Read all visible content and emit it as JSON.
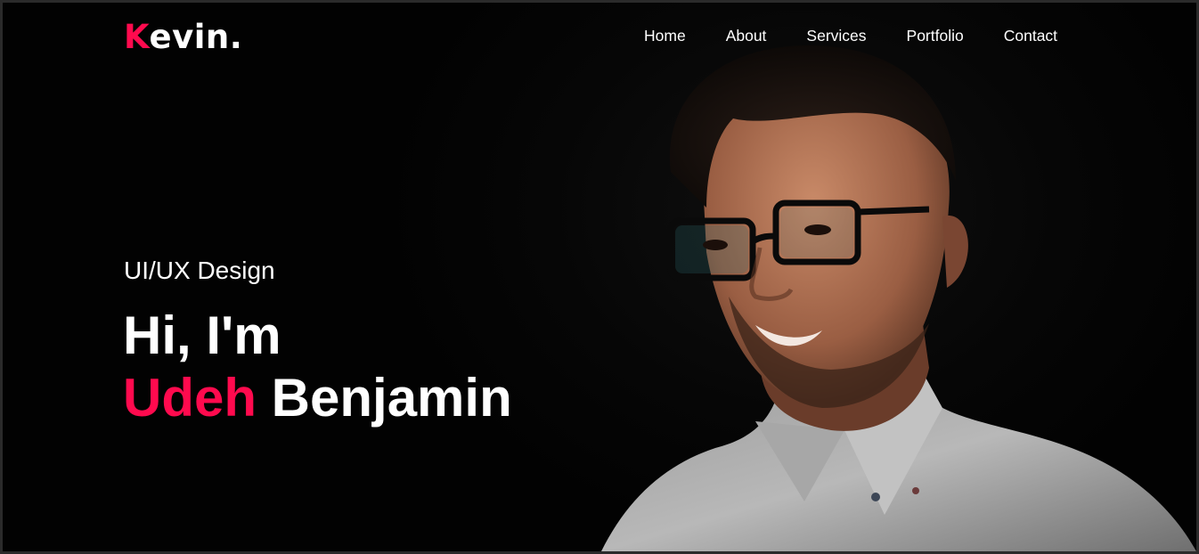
{
  "brand": {
    "first_letter": "K",
    "rest": "evin."
  },
  "nav": {
    "items": [
      {
        "label": "Home"
      },
      {
        "label": "About"
      },
      {
        "label": "Services"
      },
      {
        "label": "Portfolio"
      },
      {
        "label": "Contact"
      }
    ]
  },
  "hero": {
    "subtitle": "UI/UX Design",
    "greeting": "Hi, I'm",
    "first_name": "Udeh",
    "last_name": "Benjamin"
  },
  "colors": {
    "accent": "#ff0a4e",
    "background": "#020202",
    "text": "#ffffff"
  }
}
